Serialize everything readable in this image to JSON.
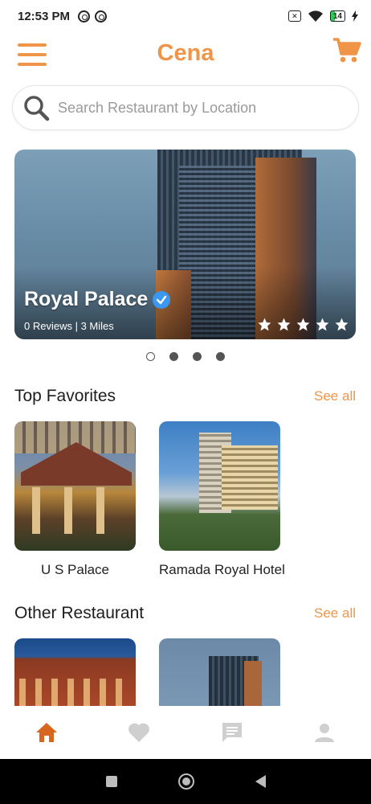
{
  "status_bar": {
    "time": "12:53 PM",
    "battery": "14"
  },
  "app_bar": {
    "title": "Cena"
  },
  "search": {
    "placeholder": "Search Restaurant by Location"
  },
  "featured": {
    "name": "Royal Palace",
    "meta": "0 Reviews | 3 Miles",
    "rating": 5,
    "carousel_pages": 4,
    "active_page": 1
  },
  "top_favorites": {
    "title": "Top Favorites",
    "see_all": "See all",
    "items": [
      {
        "name": "U S Palace"
      },
      {
        "name": "Ramada Royal Hotel"
      }
    ]
  },
  "other_restaurant": {
    "title": "Other Restaurant",
    "see_all": "See all"
  },
  "bottom_nav": {
    "items": [
      "home-icon",
      "heart-icon",
      "chat-icon",
      "profile-icon"
    ],
    "active_index": 0
  },
  "colors": {
    "accent": "#f09447",
    "nav_active": "#d9661f",
    "nav_inactive": "#cfcfcf"
  }
}
